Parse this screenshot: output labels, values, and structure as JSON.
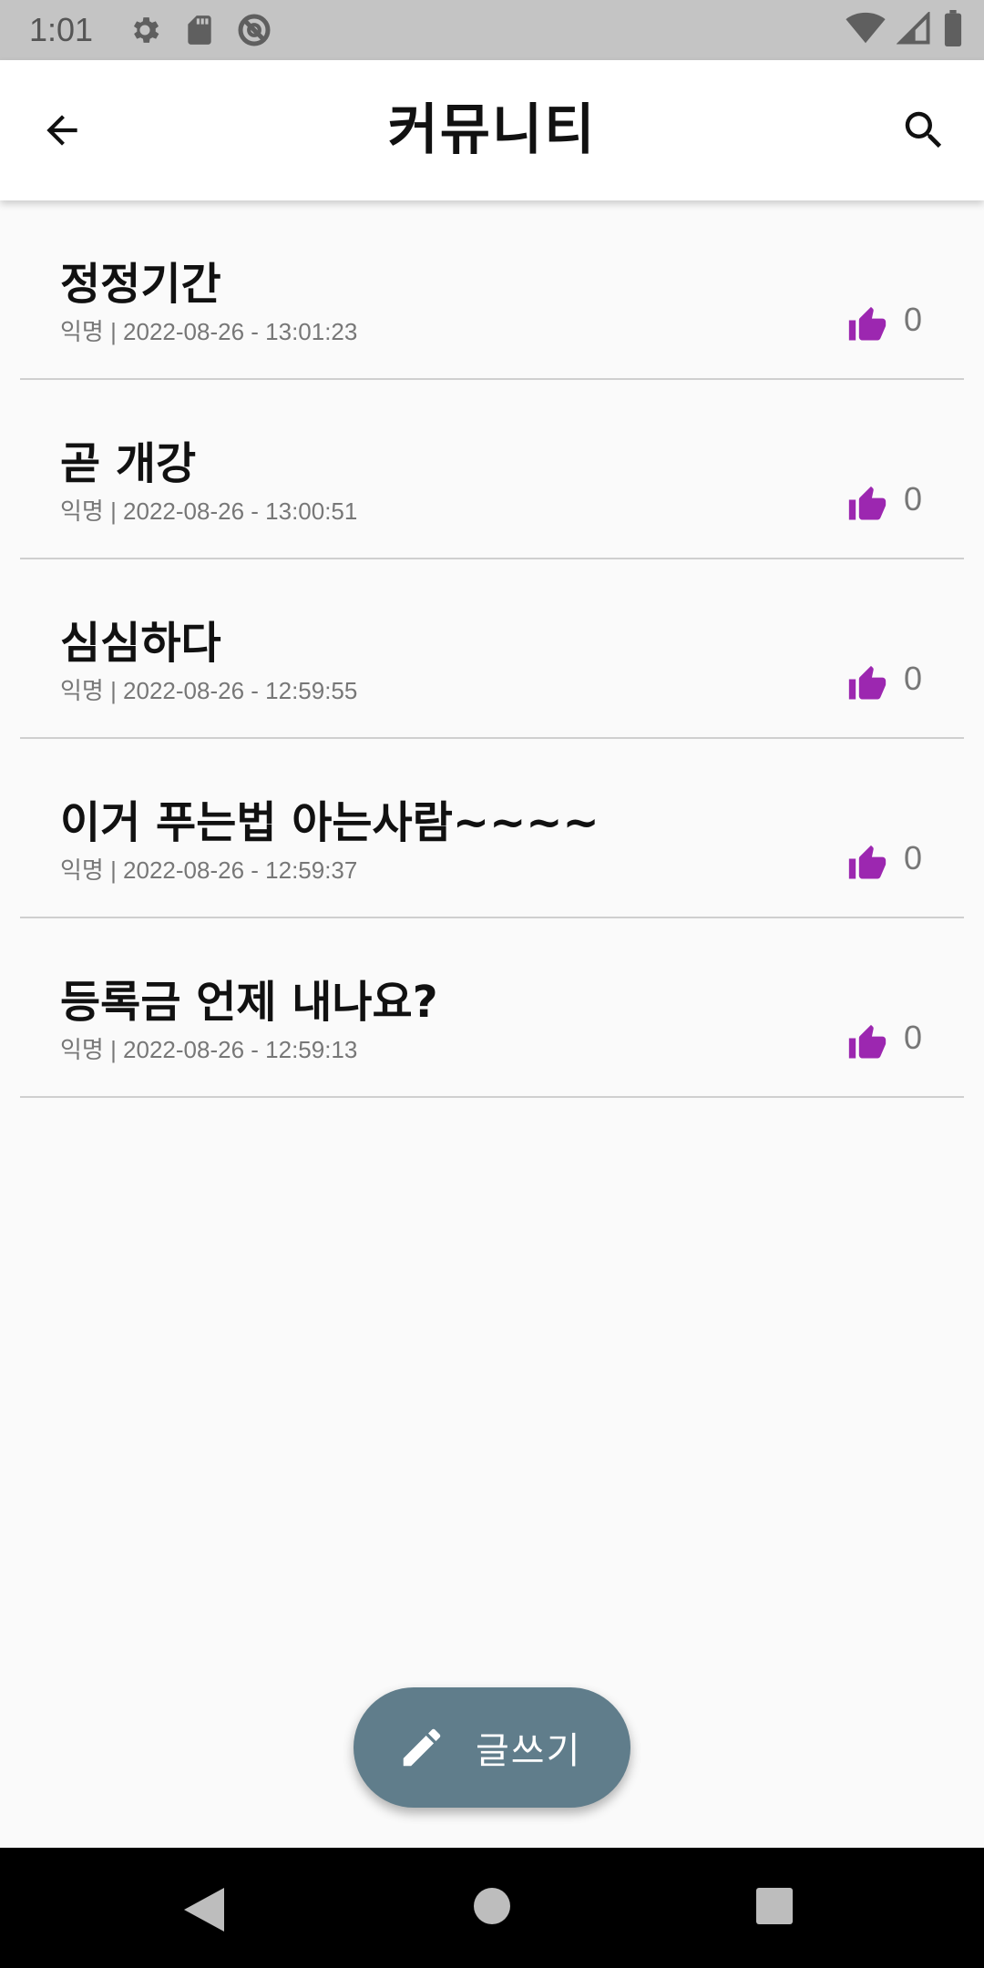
{
  "status_bar": {
    "time": "1:01",
    "icons": [
      "settings-icon",
      "sd-card-icon",
      "sync-disabled-icon",
      "wifi-icon",
      "signal-icon",
      "battery-icon"
    ]
  },
  "app_bar": {
    "title": "커뮤니티",
    "back_icon": "arrow-back-icon",
    "search_icon": "search-icon"
  },
  "posts": [
    {
      "title": "정정기간",
      "meta": "익명 | 2022-08-26 - 13:01:23",
      "likes": "0"
    },
    {
      "title": "곧 개강",
      "meta": "익명 | 2022-08-26 - 13:00:51",
      "likes": "0"
    },
    {
      "title": "심심하다",
      "meta": "익명 | 2022-08-26 - 12:59:55",
      "likes": "0"
    },
    {
      "title": "이거 푸는법 아는사람~~~~",
      "meta": "익명 | 2022-08-26 - 12:59:37",
      "likes": "0"
    },
    {
      "title": "등록금 언제 내나요?",
      "meta": "익명 | 2022-08-26 - 12:59:13",
      "likes": "0"
    }
  ],
  "fab": {
    "label": "글쓰기",
    "icon": "pencil-icon"
  },
  "colors": {
    "accent": "#9c27b0",
    "fab": "#607d8b",
    "status_bar": "#c4c4c4",
    "nav_bar": "#000000"
  }
}
